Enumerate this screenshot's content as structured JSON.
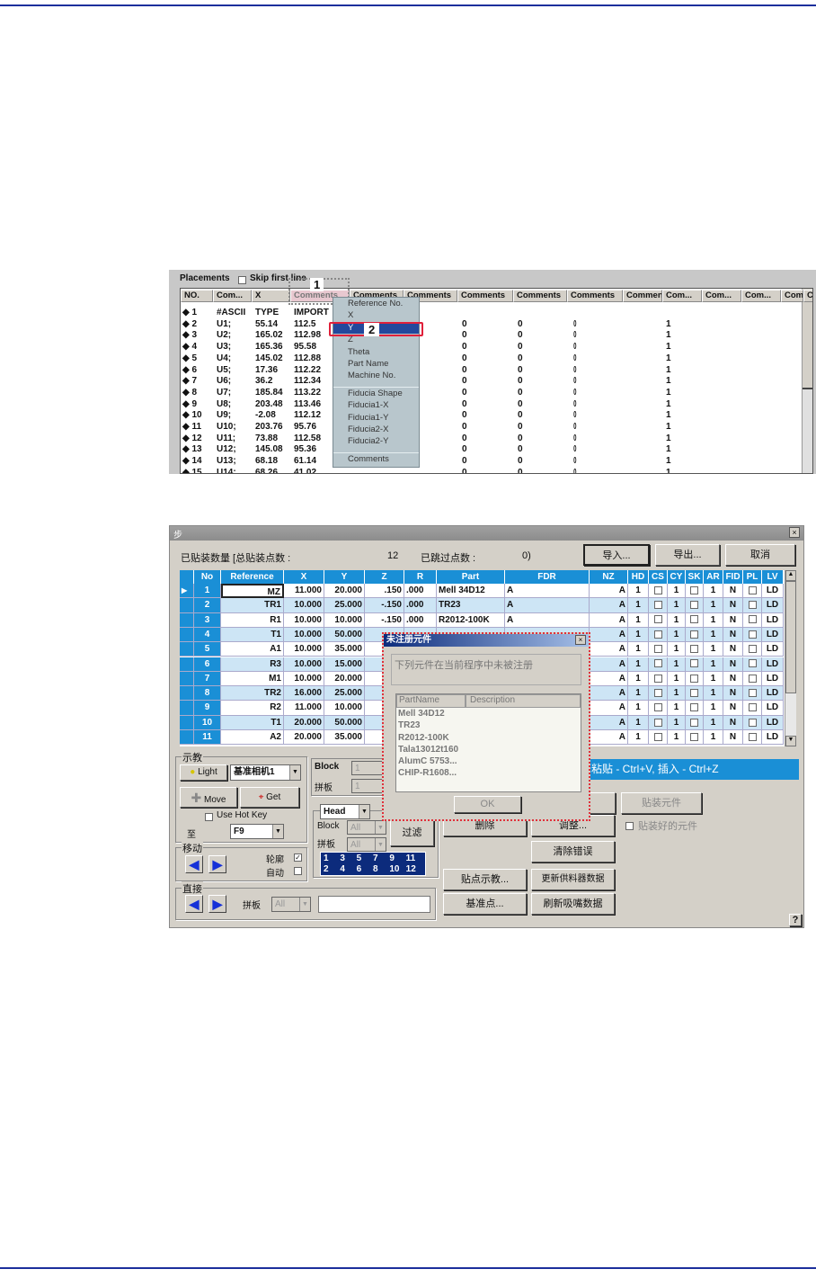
{
  "shot1": {
    "placements_label": "Placements",
    "skip_label": "Skip first line",
    "callout1": "1",
    "callout2": "2",
    "headers": [
      "NO.",
      "Com...",
      "X",
      "Comments",
      "Comments",
      "Comments",
      "Comments",
      "Comments",
      "Comments",
      "Comments",
      "Com...",
      "Com...",
      "Com...",
      "Com...",
      "Com"
    ],
    "rows": [
      [
        "1",
        "#ASCII",
        "TYPE",
        "IMPORT",
        "",
        "",
        "",
        ""
      ],
      [
        "2",
        "U1;",
        "55.14",
        "112.5",
        "0",
        "0",
        "0",
        "1"
      ],
      [
        "3",
        "U2;",
        "165.02",
        "112.98",
        "0",
        "0",
        "0",
        "1"
      ],
      [
        "4",
        "U3;",
        "165.36",
        "95.58",
        "0",
        "0",
        "0",
        "1"
      ],
      [
        "5",
        "U4;",
        "145.02",
        "112.88",
        "0",
        "0",
        "0",
        "1"
      ],
      [
        "6",
        "U5;",
        "17.36",
        "112.22",
        "0",
        "0",
        "0",
        "1"
      ],
      [
        "7",
        "U6;",
        "36.2",
        "112.34",
        "0",
        "0",
        "0",
        "1"
      ],
      [
        "8",
        "U7;",
        "185.84",
        "113.22",
        "0",
        "0",
        "0",
        "1"
      ],
      [
        "9",
        "U8;",
        "203.48",
        "113.46",
        "0",
        "0",
        "0",
        "1"
      ],
      [
        "10",
        "U9;",
        "-2.08",
        "112.12",
        "0",
        "0",
        "0",
        "1"
      ],
      [
        "11",
        "U10;",
        "203.76",
        "95.76",
        "0",
        "0",
        "0",
        "1"
      ],
      [
        "12",
        "U11;",
        "73.88",
        "112.58",
        "0",
        "0",
        "0",
        "1"
      ],
      [
        "13",
        "U12;",
        "145.08",
        "95.36",
        "0",
        "0",
        "0",
        "1"
      ],
      [
        "14",
        "U13;",
        "68.18",
        "61.14",
        "0",
        "0",
        "0",
        "1"
      ],
      [
        "15",
        "U14;",
        "68.26",
        "41.02",
        "0",
        "0",
        "0",
        "1"
      ]
    ],
    "menu": [
      "Reference No.",
      "X",
      "Y",
      "Z",
      "Theta",
      "Part Name",
      "Machine No.",
      "-",
      "Fiducia Shape",
      "Fiducia1-X",
      "Fiducia1-Y",
      "Fiducia2-X",
      "Fiducia2-Y",
      "-",
      "Comments"
    ],
    "menu_selected": "Y"
  },
  "shot2": {
    "title": "步",
    "close": "×",
    "count_label": "已贴装数量 [总贴装点数 :",
    "total": "12",
    "skipped_label": "已跳过点数 :",
    "skipped": "0)",
    "import": "导入...",
    "export": "导出...",
    "cancel": "取消",
    "headers": [
      "",
      "No",
      "Reference",
      "X",
      "Y",
      "Z",
      "R",
      "Part",
      "FDR",
      "NZ",
      "HD",
      "CS",
      "CY",
      "SK",
      "AR",
      "FID",
      "PL",
      "LV"
    ],
    "rows": [
      [
        "1",
        "MZ",
        "11.000",
        "20.000",
        ".150",
        ".000",
        "Mell 34D12",
        "A",
        "A",
        "1",
        "☐",
        "1",
        "☐",
        "1",
        "N",
        "☐",
        "LD"
      ],
      [
        "2",
        "TR1",
        "10.000",
        "25.000",
        "-.150",
        ".000",
        "TR23",
        "A",
        "A",
        "1",
        "☐",
        "1",
        "☐",
        "1",
        "N",
        "☐",
        "LD"
      ],
      [
        "3",
        "R1",
        "10.000",
        "10.000",
        "-.150",
        ".000",
        "R2012-100K",
        "A",
        "A",
        "1",
        "☐",
        "1",
        "☐",
        "1",
        "N",
        "☐",
        "LD"
      ],
      [
        "4",
        "T1",
        "10.000",
        "50.000",
        "",
        "",
        "",
        "",
        "A",
        "1",
        "☐",
        "1",
        "☐",
        "1",
        "N",
        "☐",
        "LD"
      ],
      [
        "5",
        "A1",
        "10.000",
        "35.000",
        "",
        "",
        "",
        "",
        "A",
        "1",
        "☐",
        "1",
        "☐",
        "1",
        "N",
        "☐",
        "LD"
      ],
      [
        "6",
        "R3",
        "10.000",
        "15.000",
        "",
        "",
        "",
        "",
        "A",
        "1",
        "☐",
        "1",
        "☐",
        "1",
        "N",
        "☐",
        "LD"
      ],
      [
        "7",
        "M1",
        "10.000",
        "20.000",
        "",
        "",
        "",
        "",
        "A",
        "1",
        "☐",
        "1",
        "☐",
        "1",
        "N",
        "☐",
        "LD"
      ],
      [
        "8",
        "TR2",
        "16.000",
        "25.000",
        "",
        "",
        "",
        "",
        "A",
        "1",
        "☐",
        "1",
        "☐",
        "1",
        "N",
        "☐",
        "LD"
      ],
      [
        "9",
        "R2",
        "11.000",
        "10.000",
        "",
        "",
        "",
        "",
        "A",
        "1",
        "☐",
        "1",
        "☐",
        "1",
        "N",
        "☐",
        "LD"
      ],
      [
        "10",
        "T1",
        "20.000",
        "50.000",
        "",
        "",
        "",
        "",
        "A",
        "1",
        "☐",
        "1",
        "☐",
        "1",
        "N",
        "☐",
        "LD"
      ],
      [
        "11",
        "A2",
        "20.000",
        "35.000",
        "",
        "",
        "",
        "",
        "A",
        "1",
        "☐",
        "1",
        "☐",
        "1",
        "N",
        "☐",
        "LD"
      ]
    ],
    "teach": {
      "legend": "示教",
      "light": "Light",
      "camera": "基准相机1",
      "move": "Move",
      "get": "Get",
      "hotkey": "Use Hot Key",
      "to_label": "至",
      "fkey": "F9"
    },
    "moveg": {
      "legend": "移动",
      "outline": "轮廓",
      "auto": "自动"
    },
    "direct": {
      "legend": "直接",
      "board_label": "拼板",
      "board": "All"
    },
    "block_label": "Block",
    "block_val": "1",
    "panel_label": "拼板",
    "panel_val": "1",
    "head": "Head",
    "filter_block": "Block",
    "filter_board": "拼板",
    "all": "All",
    "filter_btn": "过滤",
    "heads": [
      "1",
      "3",
      "5",
      "7",
      "9",
      "11",
      "2",
      "4",
      "6",
      "8",
      "10",
      "12"
    ],
    "status": "粘贴 - Ctrl+V,  插入 - Ctrl+Z",
    "buttons": {
      "delete": "删除",
      "adjust": "调整...",
      "clear": "清除错误",
      "teach_pt": "贴点示教...",
      "update_feeder": "更新供料器数据",
      "fiducial": "基准点...",
      "refresh_nozzle": "刷新吸嘴数据",
      "place": "贴装元件"
    },
    "placed_label": "贴装好的元件",
    "help": "?",
    "popup": {
      "title": "未注册元件",
      "message": "下列元件在当前程序中未被注册",
      "col1": "PartName",
      "col2": "Description",
      "parts": [
        "Mell 34D12",
        "TR23",
        "R2012-100K",
        "Tala13012t160",
        "AlumC 5753...",
        "CHIP-R1608..."
      ],
      "ok": "OK"
    }
  }
}
